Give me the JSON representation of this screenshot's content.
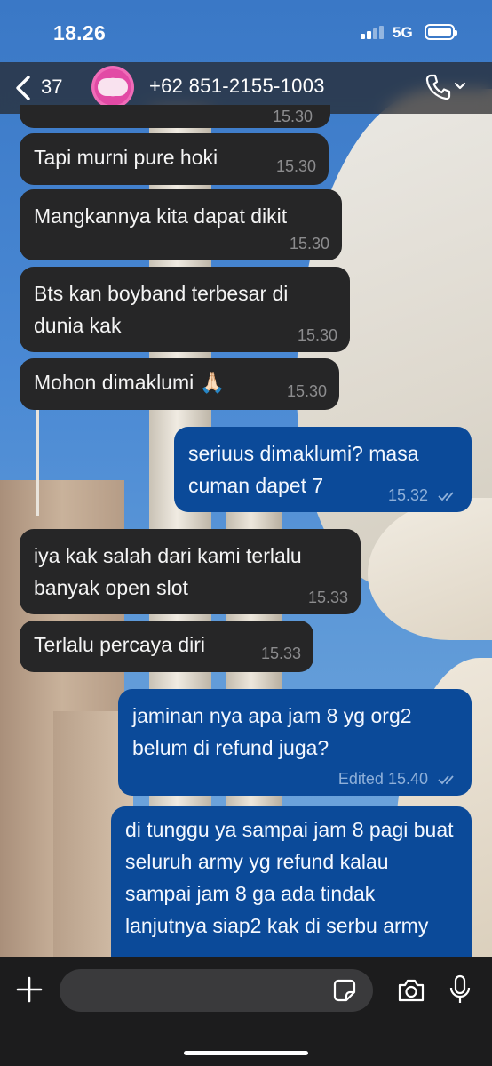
{
  "status_bar": {
    "time": "18.26",
    "network": "5G"
  },
  "header": {
    "back_count": "37",
    "contact": "+62 851-2155-1003"
  },
  "partial_top_time": "15.30",
  "messages": [
    {
      "dir": "in",
      "text": "Tapi murni pure hoki",
      "time": "15.30"
    },
    {
      "dir": "in",
      "text": "Mangkannya kita dapat dikit",
      "time": "15.30"
    },
    {
      "dir": "in",
      "text": "Bts kan boyband terbesar di dunia kak",
      "time": "15.30"
    },
    {
      "dir": "in",
      "text": "Mohon dimaklumi 🙏🏻",
      "time": "15.30"
    },
    {
      "dir": "out",
      "text": "seriuus dimaklumi? masa cuman dapet 7",
      "time": "15.32"
    },
    {
      "dir": "in",
      "text": "iya kak salah dari kami terlalu banyak open slot",
      "time": "15.33"
    },
    {
      "dir": "in",
      "text": "Terlalu percaya diri",
      "time": "15.33"
    },
    {
      "dir": "out",
      "text": "jaminan nya apa jam 8 yg org2 belum di refund juga?",
      "time": "15.40",
      "edited": "Edited"
    },
    {
      "dir": "out",
      "text": "di tunggu ya sampai jam 8 pagi buat seluruh army yg refund kalau sampai jam 8 ga ada tindak lanjutnya siap2 kak di serbu army"
    }
  ],
  "composer": {
    "placeholder": ""
  },
  "icons": [
    "back-chevron-icon",
    "phone-icon",
    "chevron-down-icon",
    "plus-icon",
    "sticker-icon",
    "camera-icon",
    "mic-icon",
    "double-check-icon"
  ]
}
